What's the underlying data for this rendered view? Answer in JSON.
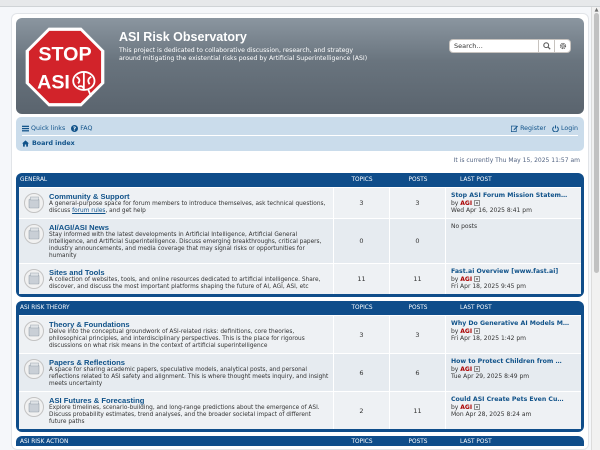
{
  "site": {
    "title": "ASI Risk Observatory",
    "description": "This project is dedicated to collaborative discussion, research, and strategy around mitigating the existential risks posed by Artificial Superintelligence (ASI)",
    "logo_text_top": "STOP",
    "logo_text_bottom": "ASI"
  },
  "search": {
    "placeholder": "Search…",
    "search_icon": "search-icon",
    "advanced_icon": "gear-icon"
  },
  "nav": {
    "quick_links": "Quick links",
    "faq": "FAQ",
    "register": "Register",
    "login": "Login",
    "board_index": "Board index"
  },
  "current_time": "It is currently Thu May 15, 2025 11:57 am",
  "columns": {
    "topics": "TOPICS",
    "posts": "POSTS",
    "last_post": "LAST POST"
  },
  "categories": [
    {
      "name": "GENERAL",
      "forums": [
        {
          "title": "Community & Support",
          "desc_before": "A general-purpose space for forum members to introduce themselves, ask technical questions, discuss ",
          "desc_link": "forum rules",
          "desc_after": ", and get help",
          "topics": "3",
          "posts": "3",
          "last_title": "Stop ASI Forum Mission Statem…",
          "last_by_prefix": "by",
          "last_author": "AGI",
          "last_time": "Wed Apr 16, 2025 8:41 pm"
        },
        {
          "title": "AI/AGI/ASI News",
          "desc_before": "Stay informed with the latest developments in Artificial Intelligence, Artificial General Intelligence, and Artificial Superintelligence. Discuss emerging breakthroughs, critical papers, industry announcements, and media coverage that may signal risks or opportunities for humanity",
          "desc_link": "",
          "desc_after": "",
          "topics": "0",
          "posts": "0",
          "last_title": "",
          "last_by_prefix": "",
          "last_author": "",
          "last_time": "No posts"
        },
        {
          "title": "Sites and Tools",
          "desc_before": "A collection of websites, tools, and online resources dedicated to artificial intelligence. Share, discover, and discuss the most important platforms shaping the future of AI, AGI, ASI, etc",
          "desc_link": "",
          "desc_after": "",
          "topics": "11",
          "posts": "11",
          "last_title": "Fast.ai Overview [www.fast.ai]",
          "last_by_prefix": "by",
          "last_author": "AGI",
          "last_time": "Fri Apr 18, 2025 9:45 pm"
        }
      ]
    },
    {
      "name": "ASI RISK THEORY",
      "forums": [
        {
          "title": "Theory & Foundations",
          "desc_before": "Delve into the conceptual groundwork of ASI-related risks: definitions, core theories, philosophical principles, and interdisciplinary perspectives. This is the place for rigorous discussions on what risk means in the context of artificial superintelligence",
          "desc_link": "",
          "desc_after": "",
          "topics": "3",
          "posts": "3",
          "last_title": "Why Do Generative AI Models M…",
          "last_by_prefix": "by",
          "last_author": "AGI",
          "last_time": "Fri Apr 18, 2025 1:42 pm"
        },
        {
          "title": "Papers & Reflections",
          "desc_before": "A space for sharing academic papers, speculative models, analytical posts, and personal reflections related to ASI safety and alignment. This is where thought meets inquiry, and insight meets uncertainty",
          "desc_link": "",
          "desc_after": "",
          "topics": "6",
          "posts": "6",
          "last_title": "How to Protect Children from …",
          "last_by_prefix": "by",
          "last_author": "AGI",
          "last_time": "Tue Apr 29, 2025 8:49 pm"
        },
        {
          "title": "ASI Futures & Forecasting",
          "desc_before": "Explore timelines, scenario-building, and long-range predictions about the emergence of ASI. Discuss probability estimates, trend analyses, and the broader societal impact of different future paths",
          "desc_link": "",
          "desc_after": "",
          "topics": "2",
          "posts": "11",
          "last_title": "Could ASI Create Pets Even Cu…",
          "last_by_prefix": "by",
          "last_author": "AGI",
          "last_time": "Mon Apr 28, 2025 8:24 am"
        }
      ]
    }
  ],
  "next_category": {
    "name": "ASI RISK ACTION",
    "topics": "TOPICS",
    "posts": "POSTS",
    "last_post": "LAST POST"
  },
  "colors": {
    "header_bg": "#69747e",
    "navbar_bg": "#cadceb",
    "forum_head": "#0f4d8a",
    "link": "#105289",
    "author": "#aa0000",
    "logo_red": "#d2232a"
  }
}
